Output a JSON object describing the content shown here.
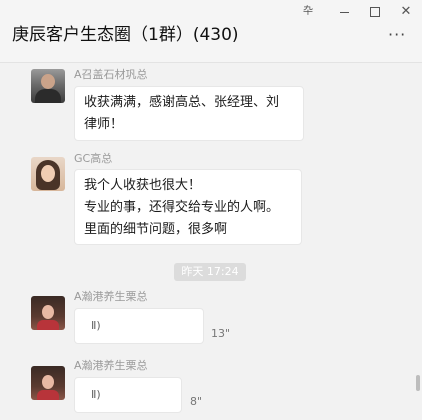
{
  "window": {
    "controls": {
      "pin": "卆",
      "minimize": "",
      "maximize": "",
      "close": "✕"
    }
  },
  "header": {
    "title": "庚辰客户生态圈（1群）(430)",
    "more": "···"
  },
  "messages": [
    {
      "sender": "A召盖石材巩总",
      "lines": [
        "收获满满，感谢高总、张经理、刘",
        "律师！"
      ]
    },
    {
      "sender": "GC高总",
      "lines": [
        "我个人收获也很大！",
        "专业的事，还得交给专业的人啊。",
        "里面的细节问题，很多啊"
      ]
    }
  ],
  "time_divider": "昨天 17:24",
  "voice_messages": [
    {
      "sender": "A瀚港养生栗总",
      "duration": "13\""
    },
    {
      "sender": "A瀚港养生栗总",
      "duration": "8\""
    }
  ],
  "icons": {
    "voice": "voice-wave-icon"
  },
  "colors": {
    "background": "#f2f2f2",
    "bubble": "#ffffff",
    "sender_text": "#9a9a9a",
    "time_chip": "#dcdcdc"
  }
}
